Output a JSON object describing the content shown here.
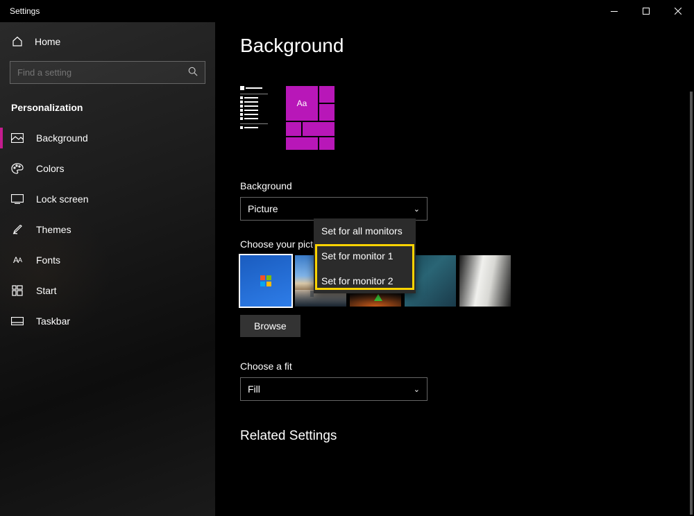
{
  "app": {
    "title": "Settings"
  },
  "sidebar": {
    "home": "Home",
    "search_placeholder": "Find a setting",
    "section": "Personalization",
    "items": [
      {
        "label": "Background",
        "active": true
      },
      {
        "label": "Colors"
      },
      {
        "label": "Lock screen"
      },
      {
        "label": "Themes"
      },
      {
        "label": "Fonts"
      },
      {
        "label": "Start"
      },
      {
        "label": "Taskbar"
      }
    ]
  },
  "main": {
    "title": "Background",
    "preview_tile_text": "Aa",
    "bg_label": "Background",
    "bg_value": "Picture",
    "choose_label": "Choose your picture",
    "browse": "Browse",
    "fit_label": "Choose a fit",
    "fit_value": "Fill",
    "related": "Related Settings"
  },
  "context_menu": {
    "items": [
      "Set for all monitors",
      "Set for monitor 1",
      "Set for monitor 2"
    ]
  }
}
